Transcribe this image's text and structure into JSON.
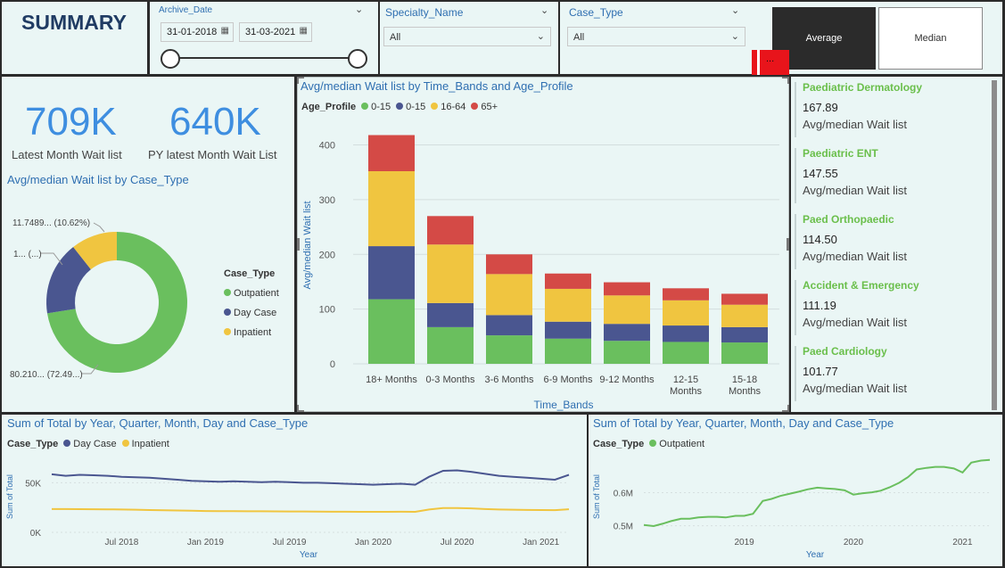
{
  "header": {
    "title": "SUMMARY"
  },
  "filters": {
    "archive_date": {
      "label": "Archive_Date",
      "start": "31-01-2018",
      "end": "31-03-2021"
    },
    "specialty": {
      "label": "Specialty_Name",
      "value": "All"
    },
    "case_type": {
      "label": "Case_Type",
      "value": "All"
    },
    "toggle": {
      "average": "Average",
      "median": "Median",
      "more": "..."
    }
  },
  "kpis": {
    "latest": {
      "value": "709K",
      "label": "Latest Month Wait list"
    },
    "py_latest": {
      "value": "640K",
      "label": "PY latest Month Wait List"
    }
  },
  "donut": {
    "title": "Avg/median Wait list by Case_Type",
    "legend_title": "Case_Type",
    "labels": {
      "inpatient": "11.7489... (10.62%)",
      "daycase": "1... (...)",
      "outpatient": "80.210... (72.49...)"
    }
  },
  "bar_chart_text": {
    "title": "Avg/median Wait list by Time_Bands and Age_Profile",
    "legend_title": "Age_Profile",
    "xlabel": "Time_Bands",
    "ylabel": "Avg/median Wait list"
  },
  "cards": [
    {
      "name": "Paediatric Dermatology",
      "value": "167.89",
      "sub": "Avg/median Wait list"
    },
    {
      "name": "Paediatric ENT",
      "value": "147.55",
      "sub": "Avg/median Wait list"
    },
    {
      "name": "Paed Orthopaedic",
      "value": "114.50",
      "sub": "Avg/median Wait list"
    },
    {
      "name": "Accident & Emergency",
      "value": "111.19",
      "sub": "Avg/median Wait list"
    },
    {
      "name": "Paed Cardiology",
      "value": "101.77",
      "sub": "Avg/median Wait list"
    }
  ],
  "line_left_text": {
    "title": "Sum of Total by Year, Quarter, Month, Day and Case_Type",
    "legend_title": "Case_Type",
    "xlabel": "Year",
    "ylabel": "Sum of Total"
  },
  "line_right_text": {
    "title": "Sum of Total by Year, Quarter, Month, Day and Case_Type",
    "legend_title": "Case_Type",
    "xlabel": "Year",
    "ylabel": "Sum of Total"
  },
  "colors": {
    "green": "#6abf5e",
    "navy": "#4a5690",
    "yellow": "#f0c540",
    "red": "#d44a46",
    "accent_blue": "#2f6fb1",
    "kpi_blue": "#3e8ee0",
    "dark_button": "#2b2b2b",
    "red_button": "#e8141b"
  },
  "chart_data": [
    {
      "type": "pie",
      "title": "Avg/median Wait list by Case_Type",
      "categories": [
        "Outpatient",
        "Day Case",
        "Inpatient"
      ],
      "values": [
        80.21,
        18.69,
        11.75
      ],
      "percent": [
        72.49,
        16.89,
        10.62
      ],
      "colors": [
        "#6abf5e",
        "#4a5690",
        "#f0c540"
      ],
      "legend": "right"
    },
    {
      "type": "bar",
      "stacked": true,
      "title": "Avg/median Wait list by Time_Bands and Age_Profile",
      "categories": [
        "18+ Months",
        "0-3 Months",
        "3-6 Months",
        "6-9 Months",
        "9-12 Months",
        "12-15 Months",
        "15-18 Months"
      ],
      "series": [
        {
          "name": "0-15",
          "color": "#6abf5e",
          "values": [
            118,
            67,
            52,
            46,
            42,
            40,
            39
          ]
        },
        {
          "name": "0-15",
          "color": "#4a5690",
          "values": [
            97,
            44,
            37,
            31,
            31,
            30,
            28
          ]
        },
        {
          "name": "16-64",
          "color": "#f0c540",
          "values": [
            137,
            107,
            75,
            60,
            52,
            46,
            41
          ]
        },
        {
          "name": "65+",
          "color": "#d44a46",
          "values": [
            66,
            52,
            36,
            28,
            24,
            22,
            20
          ]
        }
      ],
      "yticks": [
        0,
        100,
        200,
        300,
        400
      ],
      "ylim": [
        0,
        440
      ],
      "xlabel": "Time_Bands",
      "ylabel": "Avg/median Wait list",
      "legend": "top-left"
    },
    {
      "type": "line",
      "title": "Sum of Total by Year, Quarter, Month, Day and Case_Type",
      "x": [
        "2018-02",
        "2018-03",
        "2018-04",
        "2018-05",
        "2018-06",
        "2018-07",
        "2018-08",
        "2018-09",
        "2018-10",
        "2018-11",
        "2018-12",
        "2019-01",
        "2019-02",
        "2019-03",
        "2019-04",
        "2019-05",
        "2019-06",
        "2019-07",
        "2019-08",
        "2019-09",
        "2019-10",
        "2019-11",
        "2019-12",
        "2020-01",
        "2020-02",
        "2020-03",
        "2020-04",
        "2020-05",
        "2020-06",
        "2020-07",
        "2020-08",
        "2020-09",
        "2020-10",
        "2020-11",
        "2020-12",
        "2021-01",
        "2021-02",
        "2021-03"
      ],
      "xticks": [
        {
          "label": "Jul 2018",
          "x": "2018-07"
        },
        {
          "label": "Jan 2019",
          "x": "2019-01"
        },
        {
          "label": "Jul 2019",
          "x": "2019-07"
        },
        {
          "label": "Jan 2020",
          "x": "2020-01"
        },
        {
          "label": "Jul 2020",
          "x": "2020-07"
        },
        {
          "label": "Jan 2021",
          "x": "2021-01"
        }
      ],
      "series": [
        {
          "name": "Day Case",
          "color": "#4a5690",
          "values": [
            58500,
            57000,
            58000,
            57500,
            57000,
            56000,
            55500,
            55000,
            54000,
            53000,
            52000,
            51500,
            51000,
            51500,
            51000,
            50500,
            51000,
            50500,
            50000,
            50000,
            49500,
            49000,
            48500,
            48000,
            48500,
            49000,
            48000,
            56000,
            62000,
            62500,
            61000,
            59000,
            57000,
            56000,
            55000,
            54000,
            53000,
            58000
          ]
        },
        {
          "name": "Inpatient",
          "color": "#f0c540",
          "values": [
            23500,
            23500,
            23400,
            23300,
            23200,
            23000,
            22800,
            22500,
            22200,
            22000,
            21800,
            21500,
            21400,
            21300,
            21200,
            21200,
            21100,
            21000,
            21000,
            20900,
            20800,
            20800,
            20700,
            20700,
            20700,
            20800,
            20700,
            23000,
            24500,
            24500,
            24200,
            23500,
            23000,
            22800,
            22600,
            22500,
            22400,
            23300
          ]
        }
      ],
      "yticks": [
        {
          "label": "0K",
          "value": 0
        },
        {
          "label": "50K",
          "value": 50000
        }
      ],
      "ylim": [
        0,
        80000
      ],
      "xlabel": "Year",
      "ylabel": "Sum of Total",
      "legend": "top-left"
    },
    {
      "type": "line",
      "title": "Sum of Total by Year, Quarter, Month, Day and Case_Type",
      "x": [
        2018.08,
        2018.17,
        2018.25,
        2018.33,
        2018.42,
        2018.5,
        2018.58,
        2018.67,
        2018.75,
        2018.83,
        2018.92,
        2019.0,
        2019.08,
        2019.17,
        2019.25,
        2019.33,
        2019.42,
        2019.5,
        2019.58,
        2019.67,
        2019.75,
        2019.83,
        2019.92,
        2020.0,
        2020.08,
        2020.17,
        2020.25,
        2020.33,
        2020.42,
        2020.5,
        2020.58,
        2020.67,
        2020.75,
        2020.83,
        2020.92,
        2021.0,
        2021.08,
        2021.17,
        2021.25
      ],
      "xticks": [
        {
          "label": "2019",
          "x": 2019.0
        },
        {
          "label": "2020",
          "x": 2020.0
        },
        {
          "label": "2021",
          "x": 2021.0
        }
      ],
      "series": [
        {
          "name": "Outpatient",
          "color": "#6abf5e",
          "values": [
            0.502,
            0.499,
            0.506,
            0.514,
            0.521,
            0.521,
            0.525,
            0.527,
            0.527,
            0.525,
            0.53,
            0.53,
            0.536,
            0.575,
            0.581,
            0.59,
            0.597,
            0.603,
            0.61,
            0.615,
            0.613,
            0.611,
            0.607,
            0.594,
            0.598,
            0.601,
            0.606,
            0.616,
            0.63,
            0.647,
            0.67,
            0.675,
            0.678,
            0.678,
            0.673,
            0.661,
            0.691,
            0.697,
            0.699
          ]
        }
      ],
      "yticks": [
        {
          "label": "0.5M",
          "value": 0.5
        },
        {
          "label": "0.6M",
          "value": 0.6
        }
      ],
      "ylim": [
        0.48,
        0.72
      ],
      "xlabel": "Year",
      "ylabel": "Sum of Total",
      "legend": "top-left"
    }
  ]
}
